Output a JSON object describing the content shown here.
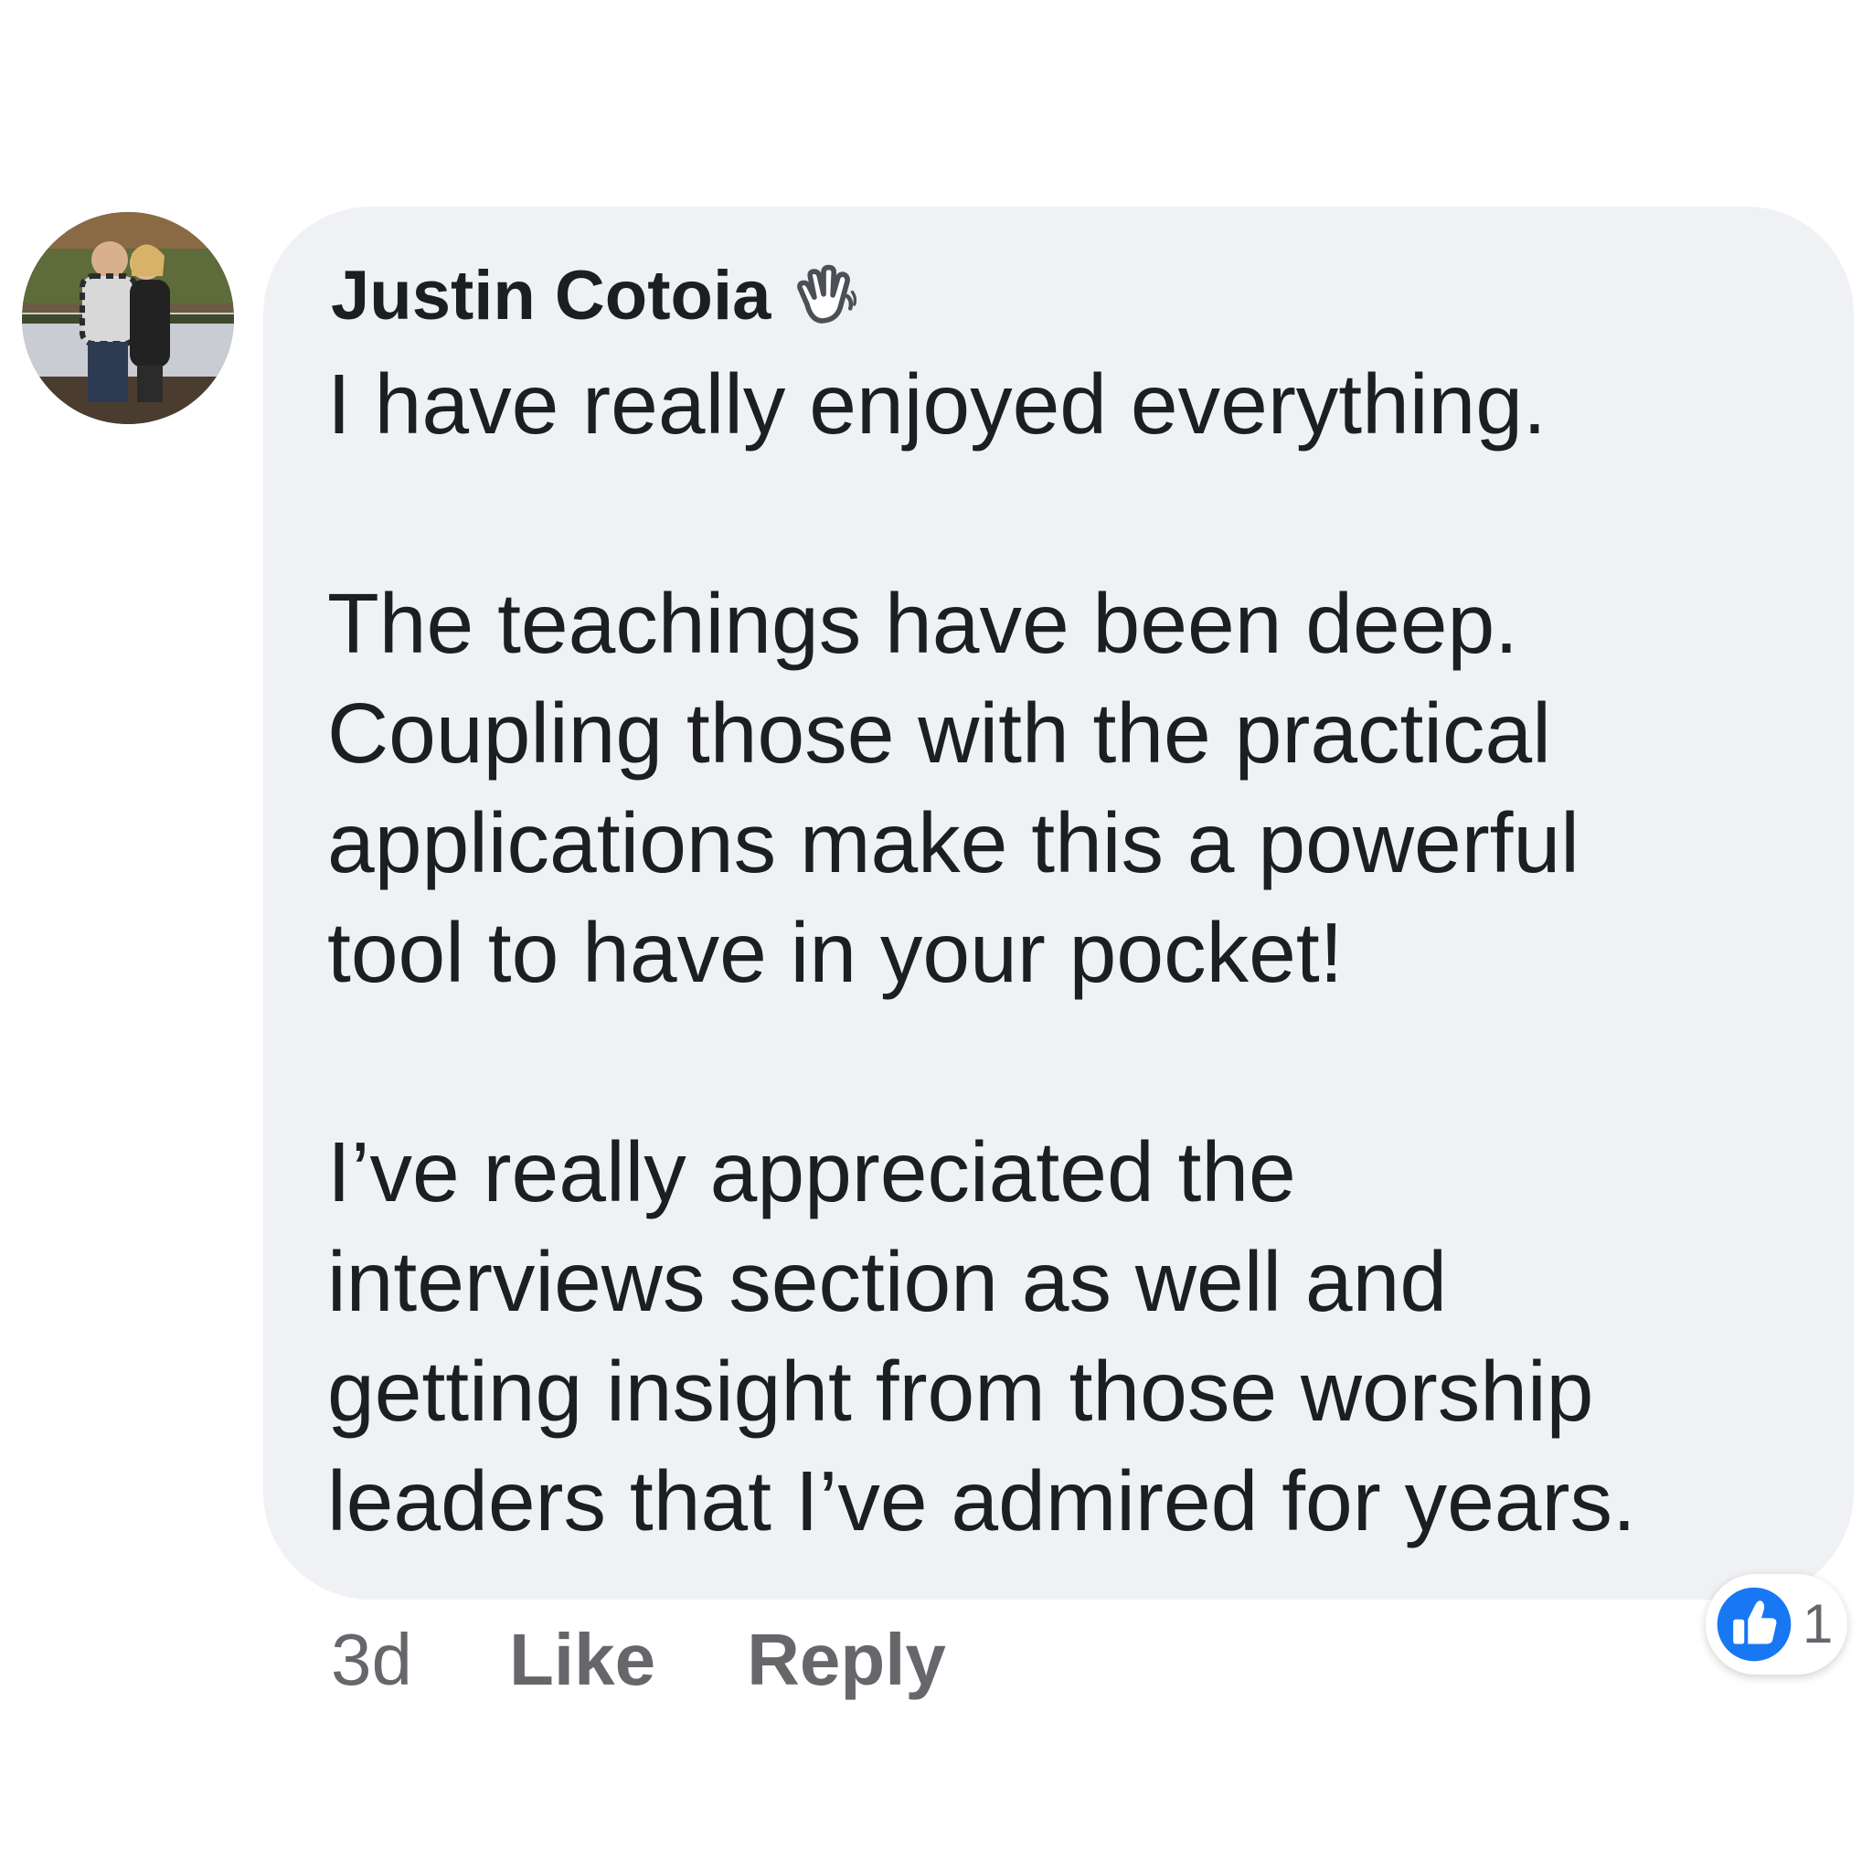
{
  "comment": {
    "author": {
      "name": "Justin Cotoia",
      "avatar_icon": "profile-photo",
      "badge_icon": "waving-hand-icon"
    },
    "paragraphs": [
      {
        "lines": [
          "I have really enjoyed everything."
        ]
      },
      {
        "lines": [
          "The teachings have been deep.",
          "Coupling those with the practical",
          "applications make this a powerful",
          "tool to have in your pocket!"
        ]
      },
      {
        "lines": [
          "I’ve really appreciated the",
          "interviews section as well and",
          "getting insight from those worship",
          "leaders that I’ve admired for years."
        ]
      }
    ],
    "timestamp": "3d",
    "like_label": "Like",
    "reply_label": "Reply",
    "reactions": {
      "icon": "thumbs-up-icon",
      "count": "1"
    }
  },
  "colors": {
    "bubble_background": "#f0f1f4",
    "text": "#1c1e21",
    "secondary_text": "#65676b",
    "like_blue": "#1877f2"
  }
}
